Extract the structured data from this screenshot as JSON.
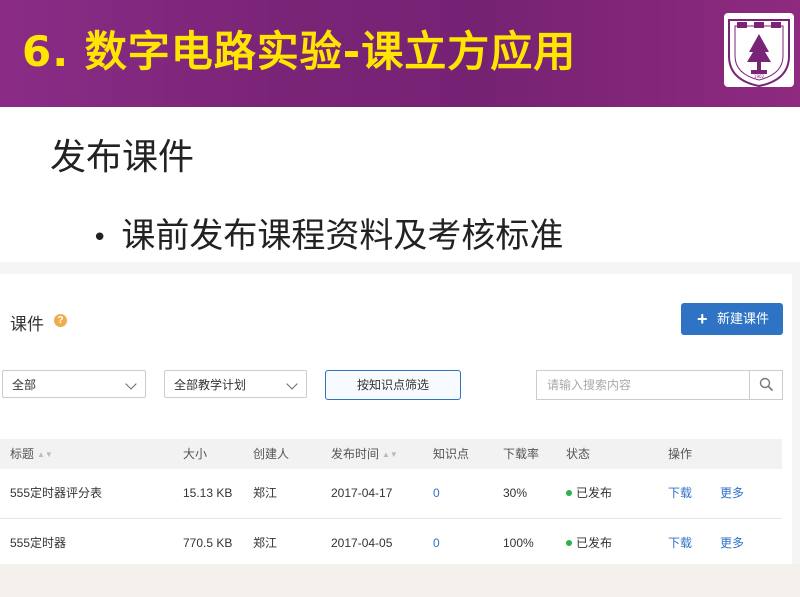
{
  "slide": {
    "title": "6. 数字电路实验-课立方应用",
    "heading": "发布课件",
    "bullet": "课前发布课程资料及考核标准",
    "logo_text": "NANJING UNIVERSITY",
    "logo_year": "1902",
    "colors": {
      "header_bg": "#7a2477",
      "title": "#ffe600"
    }
  },
  "app": {
    "page_title": "课件",
    "help_icon": "?",
    "new_button": {
      "icon": "+",
      "label": "新建课件"
    },
    "filters": {
      "scope": {
        "selected": "全部"
      },
      "plan": {
        "selected": "全部教学计划"
      },
      "knowledge_button": "按知识点筛选",
      "search_placeholder": "请输入搜索内容"
    },
    "table": {
      "columns": [
        "标题",
        "大小",
        "创建人",
        "发布时间",
        "知识点",
        "下载率",
        "状态",
        "操作"
      ],
      "rows": [
        {
          "title": "555定时器评分表",
          "size": "15.13 KB",
          "creator": "郑江",
          "date": "2017-04-17",
          "knowledge": "0",
          "rate": "30%",
          "status": "已发布",
          "download": "下载",
          "more": "更多"
        },
        {
          "title": "555定时器",
          "size": "770.5 KB",
          "creator": "郑江",
          "date": "2017-04-05",
          "knowledge": "0",
          "rate": "100%",
          "status": "已发布",
          "download": "下载",
          "more": "更多"
        }
      ]
    },
    "colors": {
      "primary": "#2f73c5",
      "published": "#2bb24c"
    }
  }
}
